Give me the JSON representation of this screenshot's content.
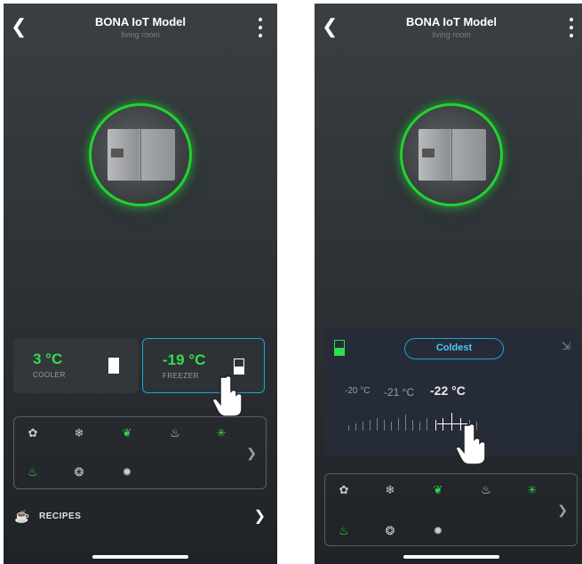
{
  "screens": [
    {
      "title": "BONA IoT Model",
      "subtitle": "living room",
      "cooler": {
        "value": "3 °C",
        "label": "COOLER"
      },
      "freezer": {
        "value": "-19 °C",
        "label": "FREEZER"
      },
      "recipes_label": "RECIPES"
    },
    {
      "title": "BONA IoT Model",
      "subtitle": "living room",
      "mode_label": "Coldest",
      "temps": [
        "-20 °C",
        "-21 °C",
        "-22 °C"
      ]
    }
  ],
  "colors": {
    "accent_green": "#2ee04a",
    "accent_blue": "#1aa3d8"
  },
  "function_icons": [
    "fan-icon",
    "snowflake-icon",
    "eco-icon",
    "lock-drop-icon",
    "sparkle-icon",
    "steam-icon",
    "bubbles-icon",
    "filter-icon"
  ]
}
